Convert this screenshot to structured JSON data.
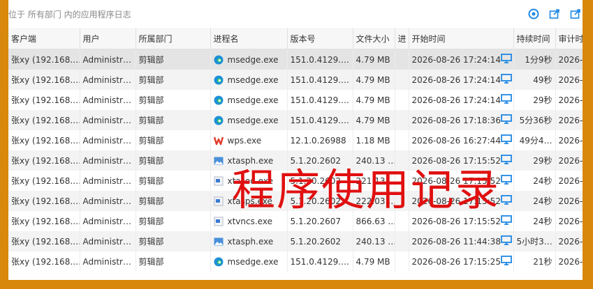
{
  "header": {
    "path": "位于 所有部门 内的应用程序日志"
  },
  "columns": [
    "客户端",
    "用户",
    "所属部门",
    "进程名",
    "版本号",
    "文件大小",
    "进",
    "开始时间",
    "持续时间",
    "审计时"
  ],
  "rows": [
    {
      "client": "张xy (192.168.…",
      "user": "Administr…",
      "dept": "剪辑部",
      "proc": "msedge.exe",
      "icon": "edge-icon",
      "ver": "151.0.4129.…",
      "size": "4.79 MB",
      "start": "2026-08-26 17:24:14",
      "dur": "1分9秒",
      "audit": "2026-"
    },
    {
      "client": "张xy (192.168.…",
      "user": "Administr…",
      "dept": "剪辑部",
      "proc": "msedge.exe",
      "icon": "edge-icon",
      "ver": "151.0.4129.…",
      "size": "4.79 MB",
      "start": "2026-08-26 17:24:14",
      "dur": "49秒",
      "audit": "2026-"
    },
    {
      "client": "张xy (192.168.…",
      "user": "Administr…",
      "dept": "剪辑部",
      "proc": "msedge.exe",
      "icon": "edge-icon",
      "ver": "151.0.4129.…",
      "size": "4.79 MB",
      "start": "2026-08-26 17:24:14",
      "dur": "29秒",
      "audit": "2026-"
    },
    {
      "client": "张xy (192.168.…",
      "user": "Administr…",
      "dept": "剪辑部",
      "proc": "msedge.exe",
      "icon": "edge-icon",
      "ver": "151.0.4129.…",
      "size": "4.79 MB",
      "start": "2026-08-26 17:18:36",
      "dur": "5分36秒",
      "audit": "2026-"
    },
    {
      "client": "张xy (192.168.…",
      "user": "Administr…",
      "dept": "剪辑部",
      "proc": "wps.exe",
      "icon": "wps-icon",
      "ver": "12.1.0.26988",
      "size": "1.18 MB",
      "start": "2026-08-26 16:27:44",
      "dur": "49分4…",
      "audit": "2026-"
    },
    {
      "client": "张xy (192.168.…",
      "user": "Administr…",
      "dept": "剪辑部",
      "proc": "xtasph.exe",
      "icon": "image-icon",
      "ver": "5.1.20.2602",
      "size": "240.13 …",
      "start": "2026-08-26 17:15:52",
      "dur": "29秒",
      "audit": "2026-"
    },
    {
      "client": "张xy (192.168.…",
      "user": "Administr…",
      "dept": "剪辑部",
      "proc": "xtasod.exe",
      "icon": "app-icon",
      "ver": "5.1.20.2602",
      "size": "221.13 …",
      "start": "2026-08-26 17:15:52",
      "dur": "24秒",
      "audit": "2026-"
    },
    {
      "client": "张xy (192.168.…",
      "user": "Administr…",
      "dept": "剪辑部",
      "proc": "xtasps.exe",
      "icon": "app-icon",
      "ver": "5.1.20.2602",
      "size": "222.03 …",
      "start": "2026-08-26 17:15:52",
      "dur": "24秒",
      "audit": "2026-"
    },
    {
      "client": "张xy (192.168.…",
      "user": "Administr…",
      "dept": "剪辑部",
      "proc": "xtvncs.exe",
      "icon": "app-icon",
      "ver": "5.1.20.2607",
      "size": "866.63 …",
      "start": "2026-08-26 17:15:52",
      "dur": "24秒",
      "audit": "2026-"
    },
    {
      "client": "张xy (192.168.…",
      "user": "Administr…",
      "dept": "剪辑部",
      "proc": "xtasph.exe",
      "icon": "image-icon",
      "ver": "5.1.20.2602",
      "size": "240.13 …",
      "start": "2026-08-26 11:44:38",
      "dur": "5小时3…",
      "audit": "2026-"
    },
    {
      "client": "张xy (192.168.…",
      "user": "Administr…",
      "dept": "剪辑部",
      "proc": "msedge.exe",
      "icon": "edge-icon",
      "ver": "151.0.4129.…",
      "size": "4.79 MB",
      "start": "2026-08-26 17:15:25",
      "dur": "21秒",
      "audit": "2026-"
    }
  ],
  "overlay_text": "程序使用记录",
  "colors": {
    "accent": "#1e88e5",
    "border": "#d8880a",
    "overlay": "#e01010"
  }
}
